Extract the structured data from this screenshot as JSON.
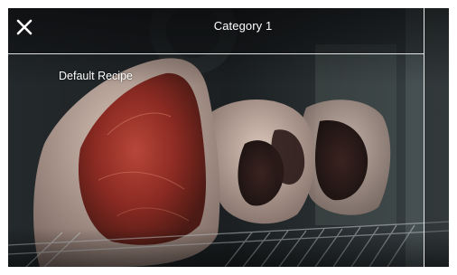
{
  "header": {
    "title": "Category 1",
    "close_icon": "close-icon"
  },
  "recipe_list": {
    "items": [
      {
        "label": "Default Recipe"
      }
    ]
  },
  "background": {
    "description_icon": "meat-in-dry-aging-cabinet-photo"
  },
  "colors": {
    "text": "#ffffff",
    "divider": "#ffffff"
  }
}
